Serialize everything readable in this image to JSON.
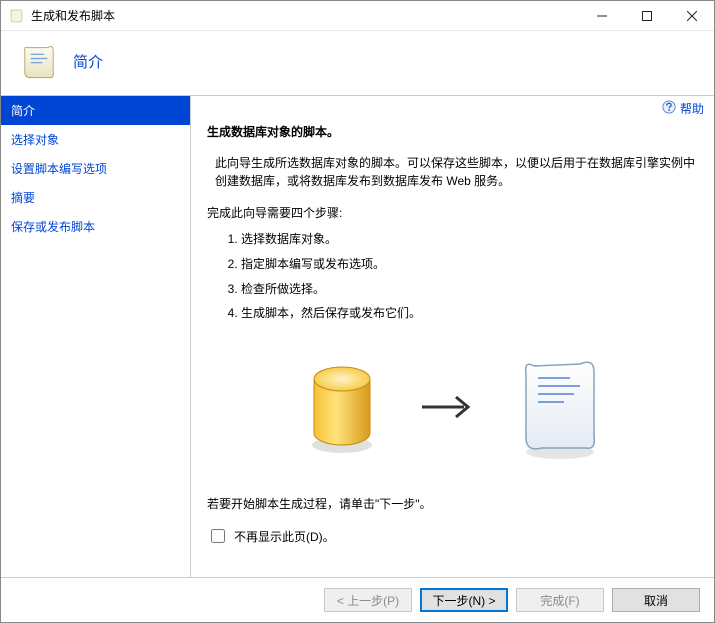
{
  "window": {
    "title": "生成和发布脚本"
  },
  "header": {
    "heading": "简介"
  },
  "sidebar": {
    "items": [
      {
        "label": "简介",
        "selected": true
      },
      {
        "label": "选择对象",
        "selected": false
      },
      {
        "label": "设置脚本编写选项",
        "selected": false
      },
      {
        "label": "摘要",
        "selected": false
      },
      {
        "label": "保存或发布脚本",
        "selected": false
      }
    ]
  },
  "help": {
    "label": "帮助"
  },
  "content": {
    "title": "生成数据库对象的脚本。",
    "intro": "此向导生成所选数据库对象的脚本。可以保存这些脚本，以便以后用于在数据库引擎实例中创建数据库，或将数据库发布到数据库发布 Web 服务。",
    "steps_heading": "完成此向导需要四个步骤:",
    "steps": [
      "选择数据库对象。",
      "指定脚本编写或发布选项。",
      "检查所做选择。",
      "生成脚本，然后保存或发布它们。"
    ],
    "start_hint": "若要开始脚本生成过程，请单击\"下一步\"。",
    "checkbox_label": "不再显示此页(D)。"
  },
  "buttons": {
    "prev": "< 上一步(P)",
    "next": "下一步(N) >",
    "finish": "完成(F)",
    "cancel": "取消"
  }
}
